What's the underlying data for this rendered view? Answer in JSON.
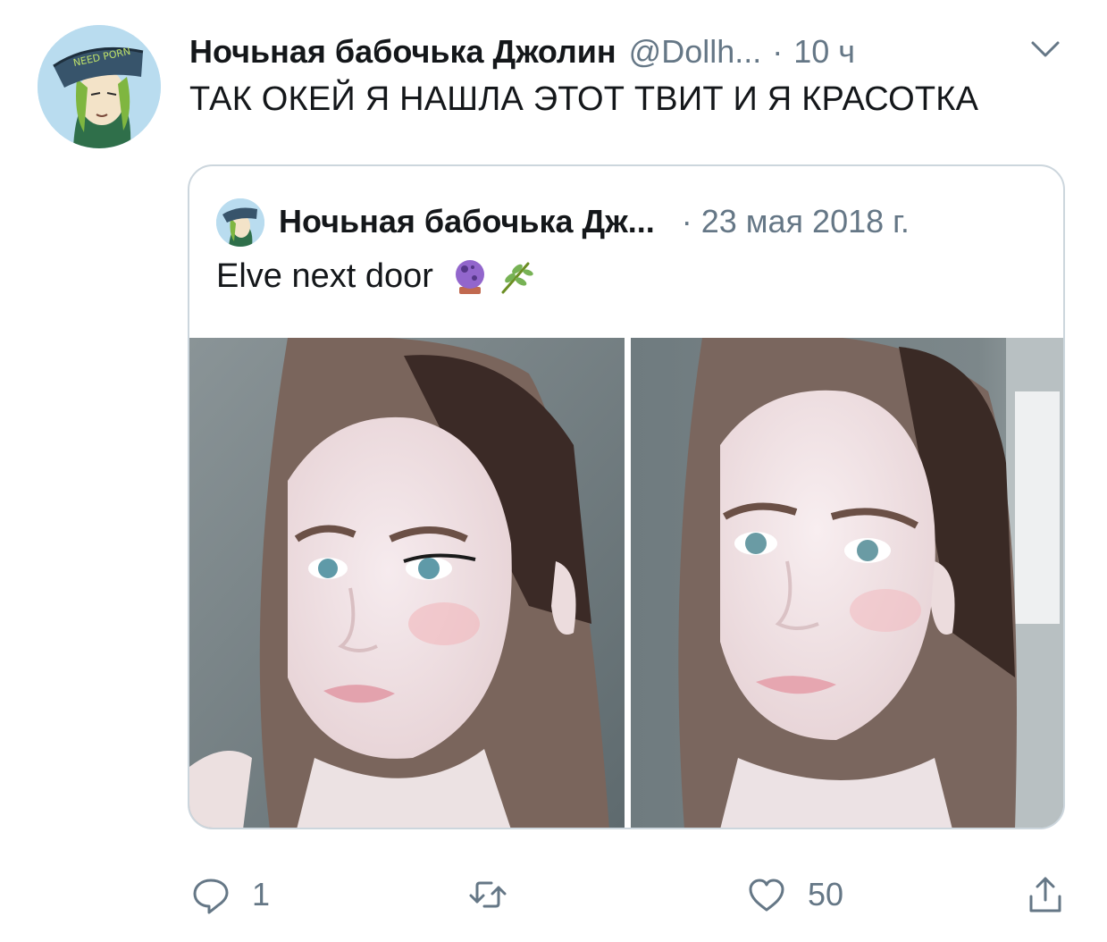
{
  "tweet": {
    "author_name": "Ночьная бабочька Джолин",
    "handle": "@Dollh...",
    "separator": "·",
    "time": "10 ч",
    "text": "ТАК ОКЕЙ Я НАШЛА ЭТОТ ТВИТ И Я КРАСОТКА",
    "avatar_text": "NEED PORN"
  },
  "quoted": {
    "author_name": "Ночьная бабочька Дж...",
    "separator": "·",
    "date": "23 мая 2018 г.",
    "text": "Elve next door",
    "emojis": [
      "crystal-ball-icon",
      "herb-icon"
    ],
    "photos_count": 2
  },
  "actions": {
    "reply_count": "1",
    "retweet_count": "",
    "like_count": "50"
  },
  "colors": {
    "text": "#14171a",
    "secondary": "#657786",
    "border": "#ccd6dd"
  }
}
